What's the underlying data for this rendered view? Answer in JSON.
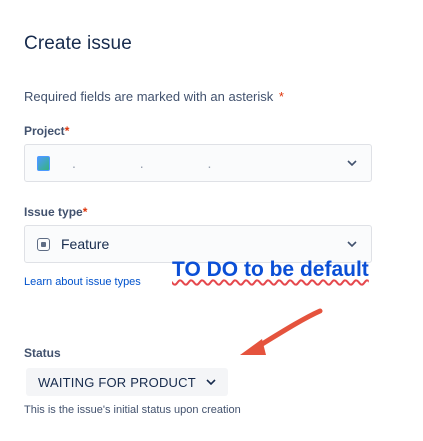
{
  "page": {
    "title": "Create issue",
    "required_note": "Required fields are marked with an asterisk",
    "asterisk": "*"
  },
  "project": {
    "label": "Project",
    "value": ".   .   .",
    "icon": "project-avatar-icon"
  },
  "issue_type": {
    "label": "Issue type",
    "value": "Feature",
    "icon": "feature-issue-icon",
    "learn_link": "Learn about issue types"
  },
  "annotation": {
    "text": "TO DO to be default",
    "arrow_color": "#e5533d",
    "text_color": "#0b4fd6"
  },
  "status": {
    "label": "Status",
    "value": "WAITING FOR PRODUCT",
    "hint": "This is the issue's initial status upon creation"
  },
  "colors": {
    "accent": "#0052cc",
    "required": "#de350b"
  }
}
